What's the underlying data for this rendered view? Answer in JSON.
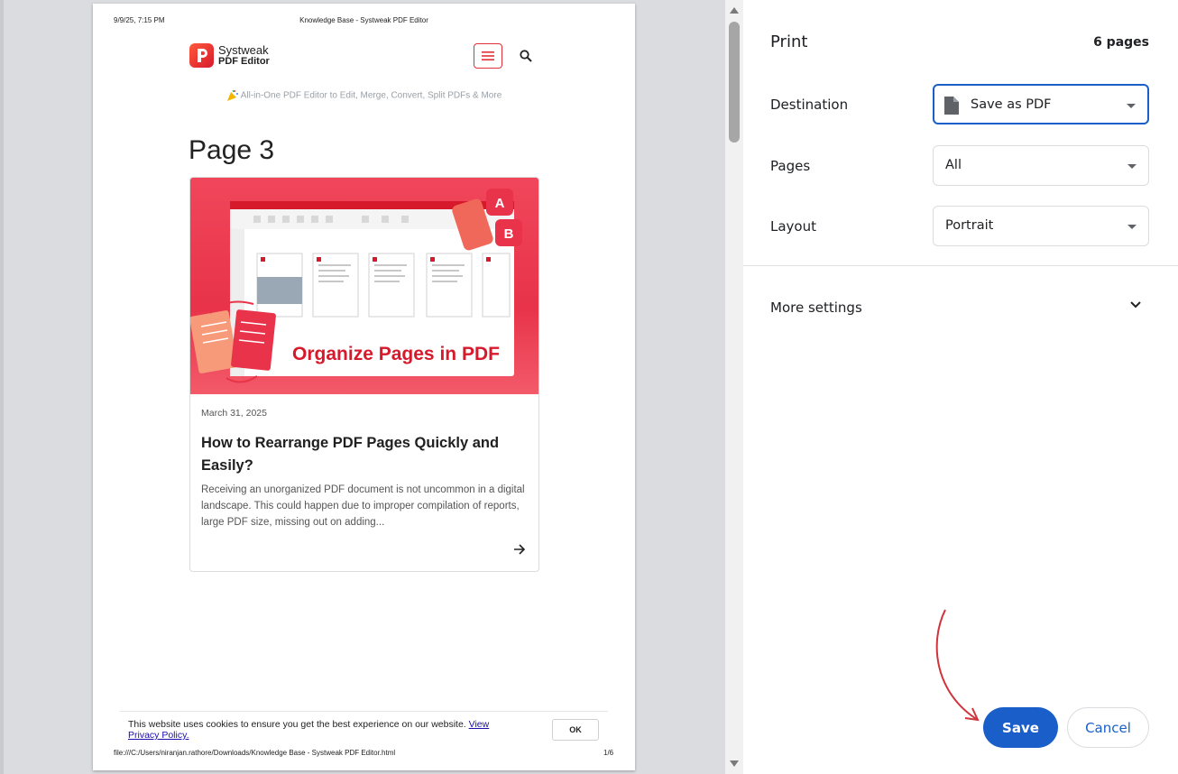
{
  "preview": {
    "header_date": "9/9/25, 7:15 PM",
    "header_title": "Knowledge Base - Systweak PDF Editor",
    "logo": {
      "line1": "Systweak",
      "line2": "PDF Editor"
    },
    "tagline": "All-in-One PDF Editor to Edit, Merge, Convert, Split PDFs & More",
    "heading": "Page 3",
    "card": {
      "image_caption": "Organize Pages in PDF",
      "date": "March 31, 2025",
      "title": "How to Rearrange PDF Pages Quickly and Easily?",
      "excerpt": "Receiving an unorganized PDF document is not uncommon in a digital landscape. This could happen due to improper compilation of reports, large PDF size, missing out on adding..."
    },
    "cookie": {
      "text": "This website uses cookies to ensure you get the best experience on our website.",
      "link": "View Privacy Policy.",
      "ok": "OK"
    },
    "footer_path": "file:///C:/Users/niranjan.rathore/Downloads/Knowledge Base - Systweak PDF Editor.html",
    "footer_page": "1/6"
  },
  "settings": {
    "title": "Print",
    "page_count": "6 pages",
    "destination": {
      "label": "Destination",
      "value": "Save as PDF"
    },
    "pages": {
      "label": "Pages",
      "value": "All"
    },
    "layout": {
      "label": "Layout",
      "value": "Portrait"
    },
    "more_settings": "More settings",
    "save": "Save",
    "cancel": "Cancel"
  },
  "colors": {
    "accent": "#1a5fc9",
    "brand_red": "#e8334a",
    "annotation": "#d0343c"
  }
}
